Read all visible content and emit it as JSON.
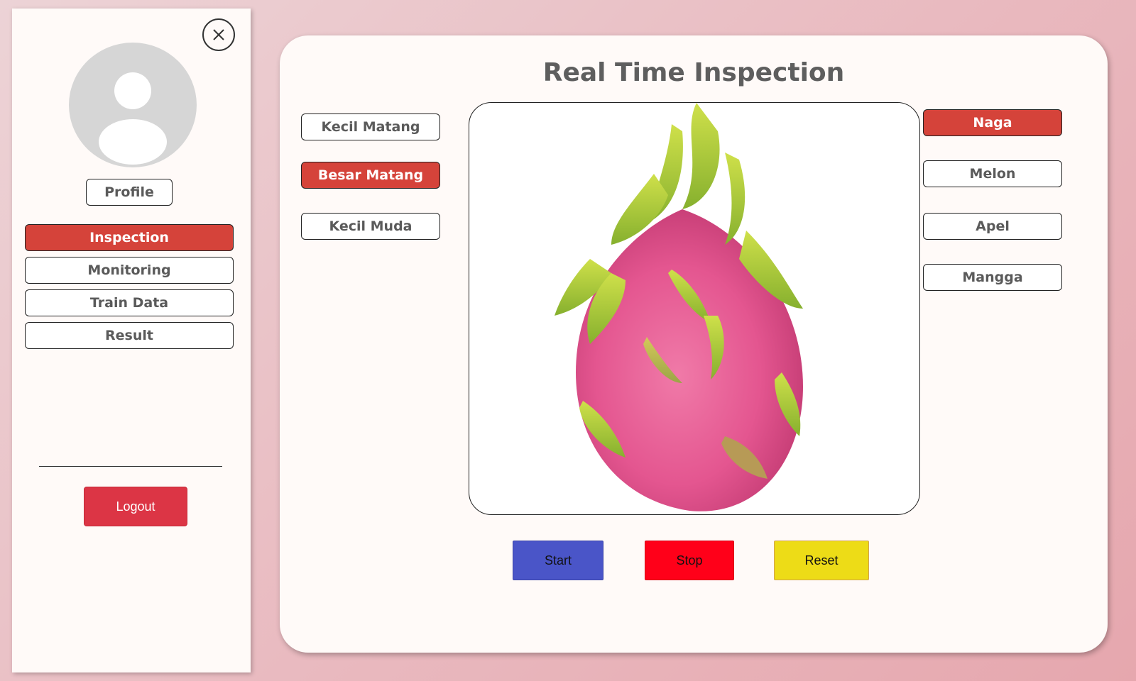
{
  "sidebar": {
    "profile_label": "Profile",
    "nav": [
      {
        "label": "Inspection",
        "active": true
      },
      {
        "label": "Monitoring",
        "active": false
      },
      {
        "label": "Train Data",
        "active": false
      },
      {
        "label": "Result",
        "active": false
      }
    ],
    "logout_label": "Logout"
  },
  "main": {
    "title": "Real Time Inspection",
    "categories": [
      {
        "label": "Kecil Matang",
        "active": false
      },
      {
        "label": "Besar Matang",
        "active": true
      },
      {
        "label": "Kecil Muda",
        "active": false
      }
    ],
    "fruits": [
      {
        "label": "Naga",
        "active": true
      },
      {
        "label": "Melon",
        "active": false
      },
      {
        "label": "Apel",
        "active": false
      },
      {
        "label": "Mangga",
        "active": false
      }
    ],
    "controls": {
      "start_label": "Start",
      "stop_label": "Stop",
      "reset_label": "Reset"
    }
  },
  "colors": {
    "accent": "#d5433a",
    "logout": "#dc3545",
    "start": "#4a55c8",
    "stop": "#ff0019",
    "reset": "#eddc17"
  }
}
